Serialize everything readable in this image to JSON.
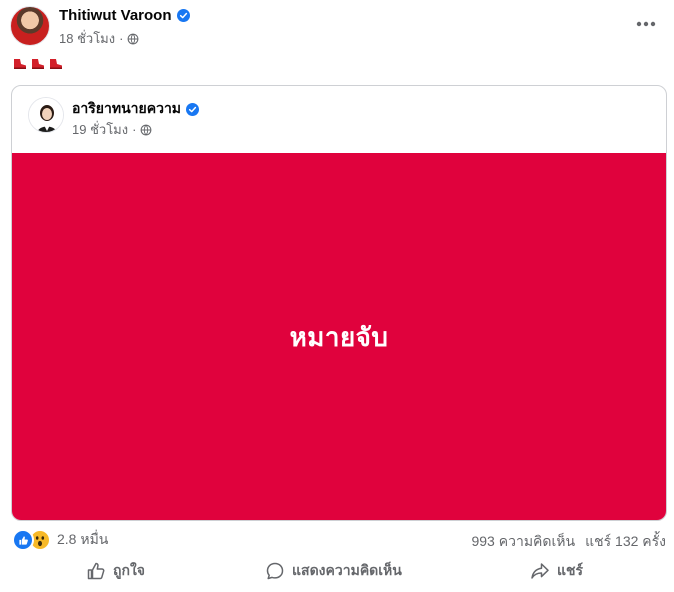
{
  "post": {
    "author": "Thitiwut Varoon",
    "timestamp": "18 ชั่วโมง",
    "separator": "·",
    "audience_icon": "globe-icon",
    "more_icon": "more-options-icon",
    "caption_emojis": [
      "red-shoe-emoji",
      "red-shoe-emoji",
      "red-shoe-emoji"
    ]
  },
  "shared": {
    "author": "อาริยาทนายความ",
    "timestamp": "19 ชั่วโมง",
    "separator": "·",
    "panel_text": "หมายจับ",
    "panel_color": "#e0023d"
  },
  "stats": {
    "reaction_count": "2.8 หมื่น",
    "comments": "993 ความคิดเห็น",
    "shares": "แชร์ 132 ครั้ง"
  },
  "actions": {
    "like": "ถูกใจ",
    "comment": "แสดงความคิดเห็น",
    "share": "แชร์"
  },
  "colors": {
    "verified": "#1877f2",
    "secondary_text": "#65676b",
    "like_reaction": "#1877f2",
    "wow_reaction": "#f7b928"
  }
}
